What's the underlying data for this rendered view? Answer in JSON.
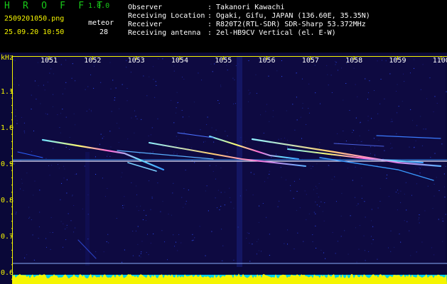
{
  "header": {
    "app_title": "H R O F F T",
    "app_version": "1.0.0",
    "filename": "2509201050.png",
    "timestamp": "25.09.20 10:50",
    "meteor_label": "meteor",
    "meteor_count": "28",
    "info": [
      {
        "label": "Observer",
        "value": ": Takanori Kawachi"
      },
      {
        "label": "Receiving Location",
        "value": ": Ogaki, Gifu, JAPAN (136.60E, 35.35N)"
      },
      {
        "label": "Receiver",
        "value": ": R820T2(RTL-SDR) SDR-Sharp 53.372MHz"
      },
      {
        "label": "Receiving antenna",
        "value": ": 2el-HB9CV Vertical (el. E-W)"
      }
    ]
  },
  "spectrogram": {
    "y_unit": "kHz",
    "y_ticks": [
      "1.1",
      "1.0",
      "0.9",
      "0.8",
      "0.7",
      "0.6"
    ],
    "x_ticks": [
      "1051",
      "1052",
      "1053",
      "1054",
      "1055",
      "1056",
      "1057",
      "1058",
      "1059",
      "1100"
    ],
    "colors": {
      "background": "#0a0838",
      "axis": "#f5f500",
      "carrier": "#e6e6ff",
      "amplitude": "#f5f500",
      "amplitude_base": "#00d0e8"
    }
  }
}
